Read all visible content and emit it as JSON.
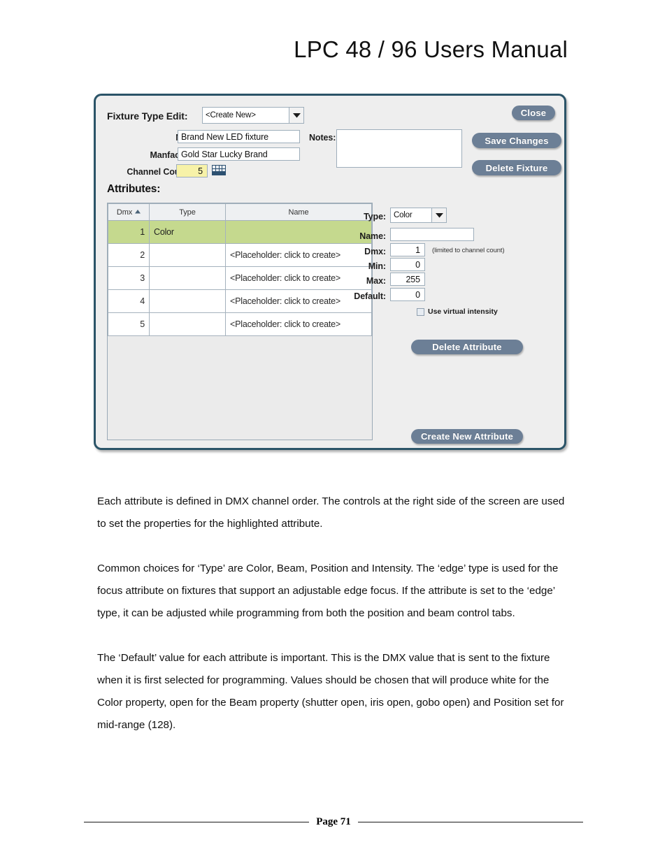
{
  "document": {
    "header_title": "LPC 48 / 96 Users Manual",
    "footer_page": "Page 71"
  },
  "dialog": {
    "fixture_type_edit_label": "Fixture Type Edit:",
    "fixture_type_value": "<Create New>",
    "name_label": "Name:",
    "name_value": "Brand New LED fixture",
    "manufacturer_label": "Manfacturer:",
    "manufacturer_value": "Gold Star Lucky Brand",
    "channel_count_label": "Channel Count:",
    "channel_count_value": "5",
    "notes_label": "Notes:",
    "notes_value": "",
    "buttons": {
      "close": "Close",
      "save_changes": "Save Changes",
      "delete_fixture": "Delete Fixture",
      "delete_attribute": "Delete Attribute",
      "create_new_attribute": "Create New Attribute"
    },
    "attributes_heading": "Attributes:",
    "table": {
      "columns": [
        "Dmx",
        "Type",
        "Name"
      ],
      "sort_column": "Dmx",
      "sort_direction": "ascending",
      "rows": [
        {
          "dmx": "1",
          "type": "Color",
          "name": "",
          "selected": true
        },
        {
          "dmx": "2",
          "type": "",
          "name": "<Placeholder: click to create>",
          "selected": false
        },
        {
          "dmx": "3",
          "type": "",
          "name": "<Placeholder: click to create>",
          "selected": false
        },
        {
          "dmx": "4",
          "type": "",
          "name": "<Placeholder: click to create>",
          "selected": false
        },
        {
          "dmx": "5",
          "type": "",
          "name": "<Placeholder: click to create>",
          "selected": false
        }
      ]
    },
    "properties": {
      "type_label": "Type:",
      "type_value": "Color",
      "name_label": "Name:",
      "name_value": "",
      "dmx_label": "Dmx:",
      "dmx_value": "1",
      "dmx_hint": "(limited to channel count)",
      "min_label": "Min:",
      "min_value": "0",
      "max_label": "Max:",
      "max_value": "255",
      "default_label": "Default:",
      "default_value": "0",
      "virtual_intensity_label": "Use virtual intensity",
      "virtual_intensity_checked": false
    },
    "colors": {
      "border": "#2b5468",
      "panel": "#eeeeee",
      "button": "#6c7f96",
      "selected_row": "#c5d98e",
      "highlight_field": "#f7f2a8"
    }
  },
  "paragraphs": [
    "Each attribute is defined in DMX channel order. The controls at the right side of the screen are used to set the properties for the highlighted attribute.",
    "Common choices for ‘Type’ are Color, Beam, Position and Intensity. The ‘edge’ type is used for the focus attribute on fixtures that support an adjustable edge focus.  If the attribute is set to the ‘edge’ type, it can be adjusted while programming from both the position and beam control tabs.",
    "The ‘Default’ value for each attribute is important.  This is the DMX value that is sent to the fixture when it is first selected for programming.  Values should be chosen that will produce white for the Color property, open for the Beam property (shutter open, iris open, gobo open) and Position set for mid-range (128)."
  ]
}
